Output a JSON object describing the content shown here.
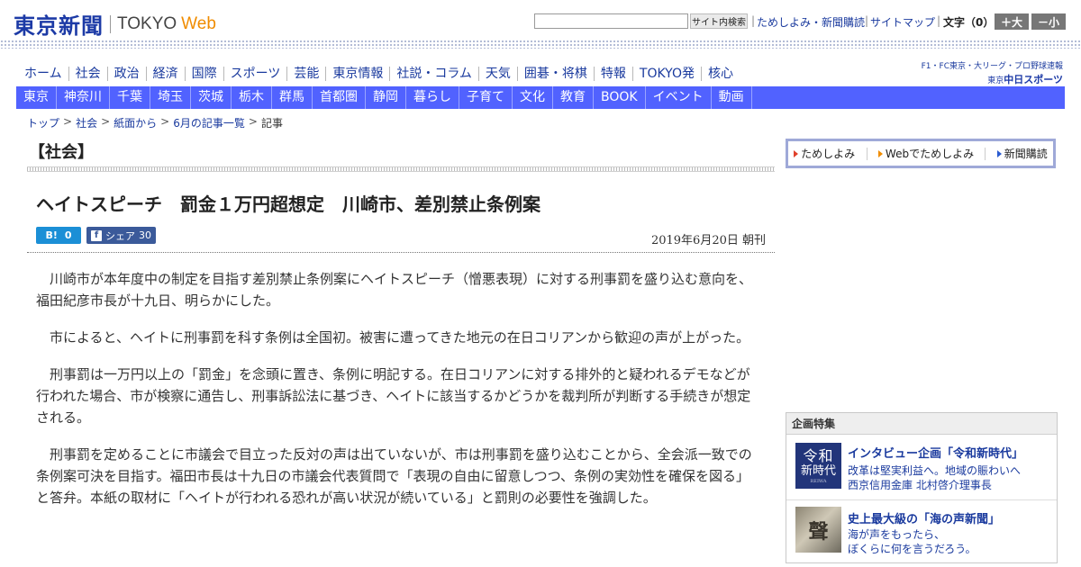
{
  "header": {
    "logo_jp": "東京新聞",
    "logo_en": "TOKYO",
    "logo_web": "Web",
    "search_button": "サイト内検索",
    "links": [
      "ためしよみ・新聞購読",
      "サイトマップ"
    ],
    "font_size_label": "文字（0）",
    "font_up": "＋大",
    "font_down": "－小"
  },
  "main_nav": [
    "ホーム",
    "社会",
    "政治",
    "経済",
    "国際",
    "スポーツ",
    "芸能",
    "東京情報",
    "社説・コラム",
    "天気",
    "囲碁・将棋",
    "特報",
    "TOKYO発",
    "核心"
  ],
  "chunichi": {
    "top": "F1・FC東京・大リーグ・プロ野球速報",
    "prefix": "東京",
    "name": "中日スポーツ"
  },
  "sub_nav": [
    "東京",
    "神奈川",
    "千葉",
    "埼玉",
    "茨城",
    "栃木",
    "群馬",
    "首都圏",
    "静岡",
    "暮らし",
    "子育て",
    "文化",
    "教育",
    "BOOK",
    "イベント",
    "動画"
  ],
  "breadcrumb": [
    "トップ",
    "社会",
    "紙面から",
    "6月の記事一覧",
    "記事"
  ],
  "article": {
    "section": "【社会】",
    "headline": "ヘイトスピーチ　罰金１万円超想定　川崎市、差別禁止条例案",
    "hatebu_label": "B!",
    "hatebu_count": "0",
    "fb_icon": "f",
    "fb_label": "シェア",
    "fb_count": "30",
    "date": "2019年6月20日 朝刊",
    "paragraphs": [
      "川崎市が本年度中の制定を目指す差別禁止条例案にヘイトスピーチ（憎悪表現）に対する刑事罰を盛り込む意向を、福田紀彦市長が十九日、明らかにした。",
      "市によると、ヘイトに刑事罰を科す条例は全国初。被害に遭ってきた地元の在日コリアンから歓迎の声が上がった。",
      "刑事罰は一万円以上の「罰金」を念頭に置き、条例に明記する。在日コリアンに対する排外的と疑われるデモなどが行われた場合、市が検察に通告し、刑事訴訟法に基づき、ヘイトに該当するかどうかを裁判所が判断する手続きが想定される。",
      "刑事罰を定めることに市議会で目立った反対の声は出ていないが、市は刑事罰を盛り込むことから、全会派一致での条例案可決を目指す。福田市長は十九日の市議会代表質問で「表現の自由に留意しつつ、条例の実効性を確保を図る」と答弁。本紙の取材に「ヘイトが行われる恐れが高い状況が続いている」と罰則の必要性を強調した。"
    ]
  },
  "promo": [
    "ためしよみ",
    "Webでためしよみ",
    "新聞購読"
  ],
  "features": {
    "heading": "企画特集",
    "items": [
      {
        "thumb_line1": "令和",
        "thumb_line2": "新時代",
        "thumb_line3": "REIWA",
        "title": "インタビュー企画「令和新時代」",
        "sub1": "改革は堅実利益へ。地域の賑わいへ",
        "sub2": "西京信用金庫 北村啓介理事長"
      },
      {
        "thumb_glyph": "聲",
        "title": "史上最大級の「海の声新聞」",
        "sub1": "海が声をもったら、",
        "sub2": "ぼくらに何を言うだろう。"
      }
    ]
  },
  "colors": {
    "brand_blue": "#1c3aa6",
    "subnav_bg": "#5162ff",
    "web_orange": "#f08c00",
    "link_blue": "#1a3a9e"
  }
}
